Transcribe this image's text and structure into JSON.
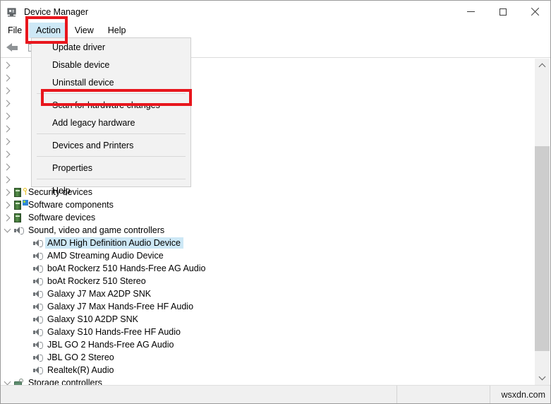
{
  "window": {
    "title": "Device Manager",
    "icon": "device-manager-icon",
    "controls": {
      "minimize": "minimize-icon",
      "maximize": "maximize-icon",
      "close": "close-icon"
    }
  },
  "menubar": {
    "items": [
      {
        "label": "File",
        "active": false
      },
      {
        "label": "Action",
        "active": true
      },
      {
        "label": "View",
        "active": false
      },
      {
        "label": "Help",
        "active": false
      }
    ]
  },
  "toolbar": {
    "back_icon": "back-arrow-icon",
    "second_icon": "properties-icon"
  },
  "action_menu": {
    "items": [
      {
        "label": "Update driver",
        "separator_after": false
      },
      {
        "label": "Disable device",
        "separator_after": false
      },
      {
        "label": "Uninstall device",
        "separator_after": true
      },
      {
        "label": "Scan for hardware changes",
        "separator_after": false
      },
      {
        "label": "Add legacy hardware",
        "separator_after": true
      },
      {
        "label": "Devices and Printers",
        "separator_after": true
      },
      {
        "label": "Properties",
        "separator_after": true
      },
      {
        "label": "Help",
        "separator_after": false
      }
    ],
    "highlighted_item": "Scan for hardware changes"
  },
  "tree": {
    "hidden_rows_count": 10,
    "categories": [
      {
        "label": "Security devices",
        "icon": "security-device-icon",
        "expanded": false
      },
      {
        "label": "Software components",
        "icon": "software-component-icon",
        "expanded": false
      },
      {
        "label": "Software devices",
        "icon": "software-device-icon",
        "expanded": false
      },
      {
        "label": "Sound, video and game controllers",
        "icon": "sound-controller-icon",
        "expanded": true
      }
    ],
    "devices": [
      {
        "label": "AMD High Definition Audio Device",
        "icon": "speaker-icon",
        "selected": true
      },
      {
        "label": "AMD Streaming Audio Device",
        "icon": "speaker-icon",
        "selected": false
      },
      {
        "label": "boAt Rockerz 510 Hands-Free AG Audio",
        "icon": "speaker-icon",
        "selected": false
      },
      {
        "label": "boAt Rockerz 510 Stereo",
        "icon": "speaker-icon",
        "selected": false
      },
      {
        "label": "Galaxy J7 Max A2DP SNK",
        "icon": "speaker-icon",
        "selected": false
      },
      {
        "label": "Galaxy J7 Max Hands-Free HF Audio",
        "icon": "speaker-icon",
        "selected": false
      },
      {
        "label": "Galaxy S10 A2DP SNK",
        "icon": "speaker-icon",
        "selected": false
      },
      {
        "label": "Galaxy S10 Hands-Free HF Audio",
        "icon": "speaker-icon",
        "selected": false
      },
      {
        "label": "JBL GO 2 Hands-Free AG Audio",
        "icon": "speaker-icon",
        "selected": false
      },
      {
        "label": "JBL GO 2 Stereo",
        "icon": "speaker-icon",
        "selected": false
      },
      {
        "label": "Realtek(R) Audio",
        "icon": "speaker-icon",
        "selected": false
      }
    ],
    "trailing_category": {
      "label": "Storage controllers",
      "icon": "storage-controller-icon",
      "expanded": true
    }
  },
  "annotations": {
    "highlight_color": "#e8161d",
    "boxes": [
      "Action",
      "Scan for hardware changes"
    ]
  },
  "scrollbar": {
    "up_arrow": "scroll-up-icon",
    "down_arrow": "scroll-down-icon"
  },
  "statusbar": {
    "watermark": "wsxdn.com"
  }
}
